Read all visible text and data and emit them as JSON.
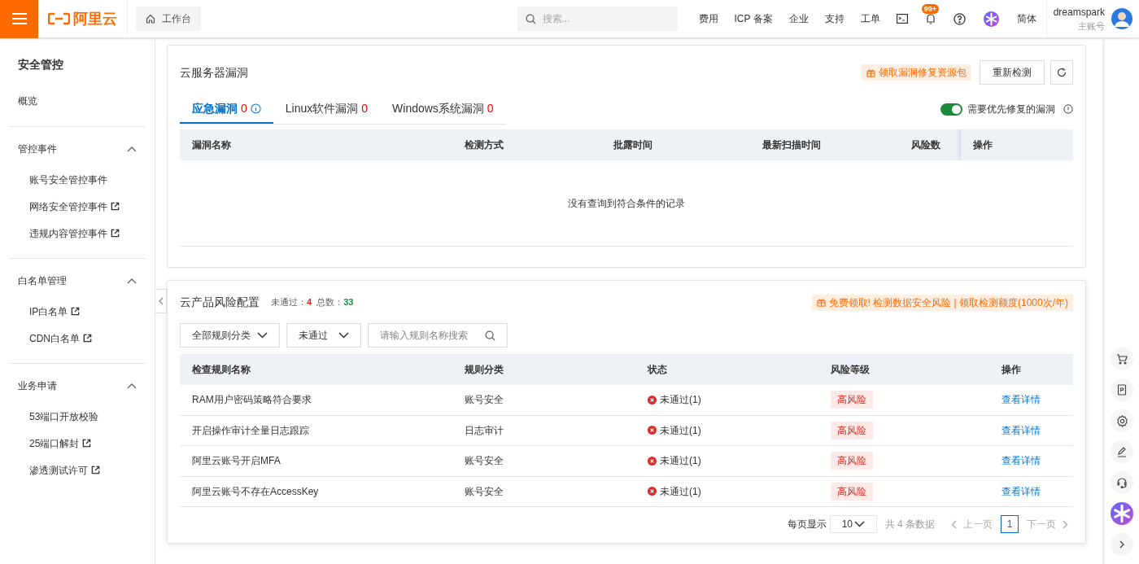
{
  "header": {
    "logo_text": "阿里云",
    "breadcrumb": "工作台",
    "search_placeholder": "搜索...",
    "nav": [
      "费用",
      "ICP 备案",
      "企业",
      "支持",
      "工单"
    ],
    "notification_badge": "99+",
    "language": "简体",
    "user": {
      "name": "dreamspark",
      "role": "主账号"
    }
  },
  "sidebar": {
    "title": "安全管控",
    "items": [
      {
        "kind": "link",
        "label": "概览"
      },
      {
        "kind": "group",
        "label": "管控事件",
        "expanded": true,
        "children": [
          {
            "label": "账号安全管控事件",
            "external": false
          },
          {
            "label": "网络安全管控事件",
            "external": true
          },
          {
            "label": "违规内容管控事件",
            "external": true
          }
        ]
      },
      {
        "kind": "group",
        "label": "白名单管理",
        "expanded": true,
        "children": [
          {
            "label": "IP白名单",
            "external": true
          },
          {
            "label": "CDN白名单",
            "external": true
          }
        ]
      },
      {
        "kind": "group",
        "label": "业务申请",
        "expanded": true,
        "children": [
          {
            "label": "53端口开放校验",
            "external": false
          },
          {
            "label": "25端口解封",
            "external": true
          },
          {
            "label": "渗透测试许可",
            "external": true
          }
        ]
      }
    ]
  },
  "vulnerabilities": {
    "title": "云服务器漏洞",
    "promo": "领取漏洞修复资源包",
    "recheck_button": "重新检测",
    "tabs": [
      {
        "label": "应急漏洞",
        "count": "0",
        "selected": true,
        "info": true
      },
      {
        "label": "Linux软件漏洞",
        "count": "0",
        "selected": false,
        "info": false
      },
      {
        "label": "Windows系统漏洞",
        "count": "0",
        "selected": false,
        "info": false
      }
    ],
    "toggle": {
      "label": "需要优先修复的漏洞",
      "on": true
    },
    "columns": [
      "漏洞名称",
      "检测方式",
      "批露时间",
      "最新扫描时间",
      "风险数",
      "操作"
    ],
    "empty_text": "没有查询到符合条件的记录"
  },
  "risk_config": {
    "title": "云产品风险配置",
    "failed_label": "未通过：",
    "failed_count": "4",
    "total_label": "总数：",
    "total_count": "33",
    "promo": "免费领取! 检测数据安全风险 | 领取检测额度(1000次/年)",
    "filters": [
      "全部规则分类",
      "未通过"
    ],
    "search_placeholder": "请输入规则名称搜索",
    "columns": [
      "检查规则名称",
      "规则分类",
      "状态",
      "风险等级",
      "操作"
    ],
    "rows": [
      {
        "name": "RAM用户密码策略符合要求",
        "category": "账号安全",
        "status": "未通过(1)",
        "risk": "高风险",
        "action": "查看详情"
      },
      {
        "name": "开启操作审计全量日志跟踪",
        "category": "日志审计",
        "status": "未通过(1)",
        "risk": "高风险",
        "action": "查看详情"
      },
      {
        "name": "阿里云账号开启MFA",
        "category": "账号安全",
        "status": "未通过(1)",
        "risk": "高风险",
        "action": "查看详情"
      },
      {
        "name": "阿里云账号不存在AccessKey",
        "category": "账号安全",
        "status": "未通过(1)",
        "risk": "高风险",
        "action": "查看详情"
      }
    ],
    "pagination": {
      "page_size_label": "每页显示",
      "page_size": "10",
      "total": "共 4 条数据",
      "prev": "上一页",
      "pages": [
        {
          "label": "1",
          "selected": true
        }
      ],
      "next": "下一页"
    }
  }
}
